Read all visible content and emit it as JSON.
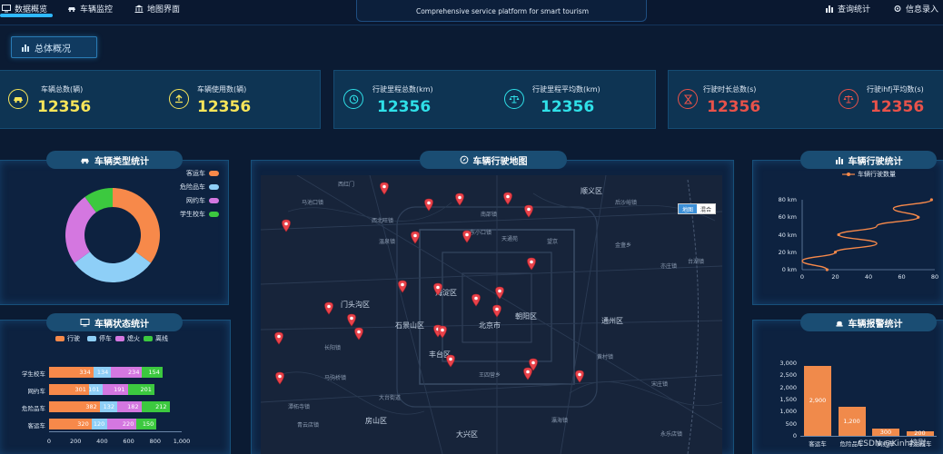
{
  "nav": {
    "left": [
      {
        "label": "数据概览",
        "icon": "monitor-icon",
        "active": true
      },
      {
        "label": "车辆监控",
        "icon": "car-icon"
      },
      {
        "label": "地图界面",
        "icon": "bank-icon"
      }
    ],
    "right": [
      {
        "label": "查询统计",
        "icon": "bar-chart-icon"
      },
      {
        "label": "信息录入",
        "icon": "gear-icon"
      }
    ]
  },
  "header": {
    "subtitle": "Comprehensive service platform for smart tourism"
  },
  "overview_tab": {
    "label": "总体概况",
    "icon": "bar-chart-icon"
  },
  "kpis": [
    {
      "label": "车辆总数(辆)",
      "value": "12356",
      "color": "#f7e55a",
      "icon": "car-icon"
    },
    {
      "label": "车辆使用数(辆)",
      "value": "12356",
      "color": "#f7e55a",
      "icon": "upload-icon"
    },
    {
      "label": "行驶里程总数(km)",
      "value": "12356",
      "color": "#2fe0e8",
      "icon": "clock-icon"
    },
    {
      "label": "行驶里程平均数(km)",
      "value": "12356",
      "color": "#2fe0e8",
      "icon": "scale-icon"
    },
    {
      "label": "行驶时长总数(s)",
      "value": "12356",
      "color": "#e8524a",
      "icon": "hourglass-icon"
    },
    {
      "label": "行驶ihfj平均数(s)",
      "value": "12356",
      "color": "#e8524a",
      "icon": "scale-icon"
    }
  ],
  "panels": {
    "vehicle_types": {
      "title": "车辆类型统计",
      "icon": "car-icon"
    },
    "vehicle_status": {
      "title": "车辆状态统计",
      "icon": "monitor-icon"
    },
    "map": {
      "title": "车辆行驶地图",
      "icon": "compass-icon"
    },
    "driving": {
      "title": "车辆行驶统计",
      "icon": "bar-chart-icon"
    },
    "alarms": {
      "title": "车辆报警统计",
      "icon": "alarm-icon"
    }
  },
  "map": {
    "toggle": [
      "地图",
      "混合"
    ],
    "big_labels": [
      "门头沟区",
      "石景山区",
      "北京市",
      "丰台区",
      "海淀区",
      "朝阳区",
      "通州区",
      "大兴区",
      "房山区",
      "顺义区"
    ],
    "small_labels": [
      "西红门",
      "马池口镇",
      "后沙峪镇",
      "南邵镇",
      "西北旺镇",
      "东小口镇",
      "温泉镇",
      "天通苑",
      "望京",
      "金盏乡",
      "亦庄镇",
      "台湖镇",
      "长阳镇",
      "黄村镇",
      "马驹桥镇",
      "宋庄镇",
      "王四营乡",
      "大台街道",
      "潭柘寺镇",
      "青云店镇",
      "瀛海镇",
      "永乐店镇"
    ]
  },
  "watermark": "CSDN @Kinh校尉",
  "chart_data": [
    {
      "type": "pie",
      "variant": "donut",
      "labels": [
        "客运车",
        "危险品车",
        "网约车",
        "学生校车"
      ],
      "values": [
        35,
        30,
        25,
        10
      ],
      "colors": [
        "#f7894a",
        "#8ecff7",
        "#d477e0",
        "#3cc93f"
      ],
      "legend": "top-right"
    },
    {
      "type": "bar",
      "orientation": "horizontal",
      "stacked": true,
      "categories": [
        "学生校车",
        "网约车",
        "危险品车",
        "客运车"
      ],
      "series": [
        {
          "name": "行驶",
          "values": [
            334,
            301,
            382,
            320
          ],
          "color": "#f7894a"
        },
        {
          "name": "停车",
          "values": [
            134,
            101,
            132,
            120
          ],
          "color": "#8ecff7"
        },
        {
          "name": "熄火",
          "values": [
            234,
            191,
            182,
            220
          ],
          "color": "#d477e0"
        },
        {
          "name": "离线",
          "values": [
            154,
            201,
            212,
            150
          ],
          "color": "#3cc93f"
        }
      ],
      "xticks": [
        "0",
        "200",
        "400",
        "600",
        "800",
        "1,000"
      ],
      "xlim": [
        0,
        1000
      ],
      "legend": "top"
    },
    {
      "type": "line",
      "smooth": true,
      "series": [
        {
          "name": "车辆行驶数量",
          "color": "#f7894a",
          "points": [
            [
              15,
              0
            ],
            [
              0,
              10
            ],
            [
              20,
              20
            ],
            [
              45,
              30
            ],
            [
              22,
              40
            ],
            [
              45,
              50
            ],
            [
              70,
              60
            ],
            [
              55,
              70
            ],
            [
              78,
              80
            ]
          ]
        }
      ],
      "xticks": [
        "0",
        "20",
        "40",
        "60",
        "80"
      ],
      "yticks": [
        "0 km",
        "20 km",
        "40 km",
        "60 km",
        "80 km"
      ],
      "xlim": [
        0,
        80
      ],
      "ylim": [
        0,
        80
      ],
      "legend": "top"
    },
    {
      "type": "bar",
      "categories": [
        "客运车",
        "危险品车",
        "网约车",
        "学生校车"
      ],
      "values": [
        2900,
        1200,
        300,
        200
      ],
      "value_labels": [
        "2,900",
        "1,200",
        "300",
        "200"
      ],
      "yticks": [
        "0",
        "500",
        "1,000",
        "1,500",
        "2,000",
        "2,500",
        "3,000"
      ],
      "ylim": [
        0,
        3000
      ],
      "color": "#f7894a"
    }
  ]
}
